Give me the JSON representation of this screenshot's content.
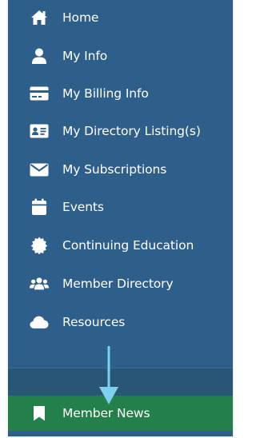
{
  "nav": {
    "items": [
      {
        "label": "Home",
        "icon": "home-icon"
      },
      {
        "label": "My Info",
        "icon": "user-icon"
      },
      {
        "label": "My Billing Info",
        "icon": "credit-card-icon"
      },
      {
        "label": "My Directory Listing(s)",
        "icon": "id-card-icon"
      },
      {
        "label": "My Subscriptions",
        "icon": "envelope-icon"
      },
      {
        "label": "Events",
        "icon": "calendar-icon"
      },
      {
        "label": "Continuing Education",
        "icon": "certificate-icon"
      },
      {
        "label": "Member Directory",
        "icon": "users-icon"
      },
      {
        "label": "Resources",
        "icon": "cloud-icon"
      }
    ],
    "active_item": {
      "label": "Member News",
      "icon": "bookmark-icon"
    }
  },
  "colors": {
    "panel_bg": "#2d5f8a",
    "divider_band": "#285676",
    "active_bg": "#24804a",
    "arrow": "#7fd0ee",
    "text": "#ffffff"
  }
}
